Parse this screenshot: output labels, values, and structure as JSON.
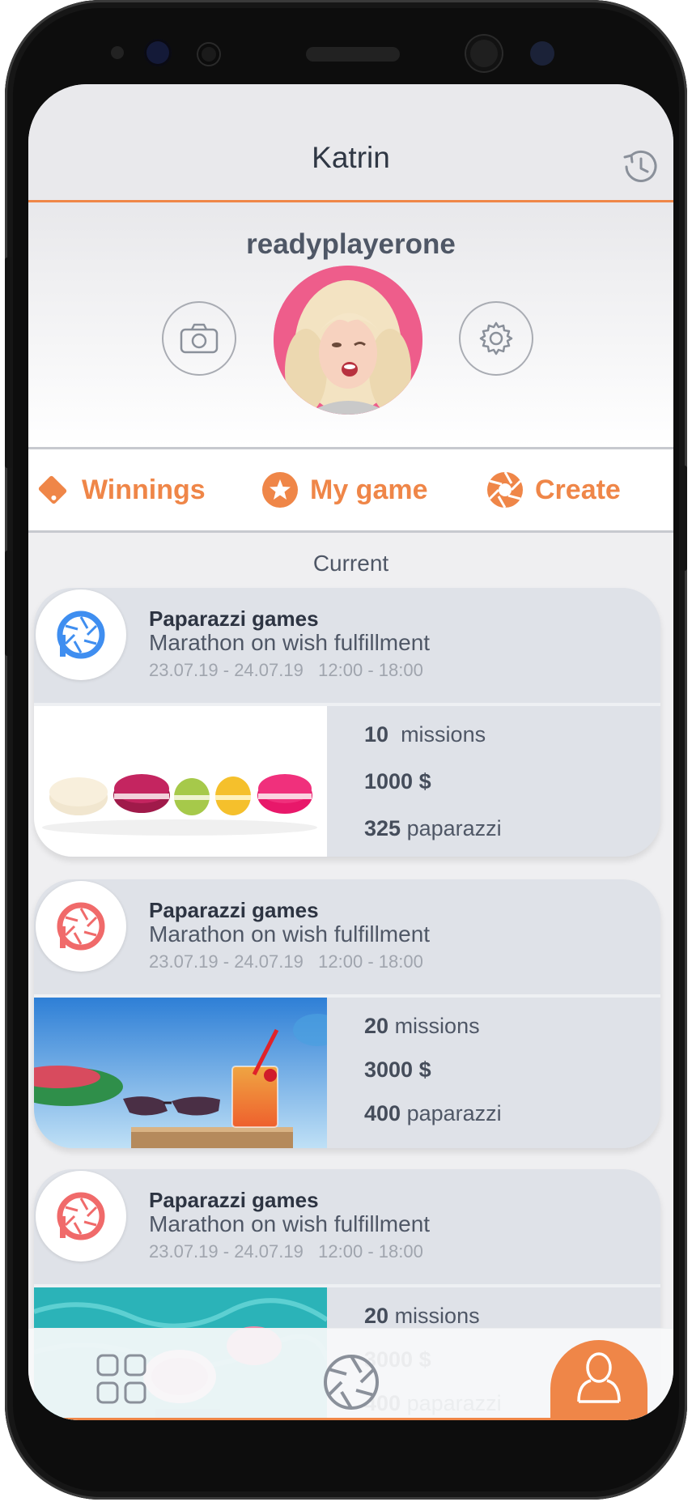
{
  "header": {
    "title": "Katrin",
    "history_icon": "history-icon"
  },
  "profile": {
    "username": "readyplayerone"
  },
  "tabs": [
    {
      "label": "Winnings",
      "icon": "ticket-icon"
    },
    {
      "label": "My game",
      "icon": "star-icon"
    },
    {
      "label": "Create",
      "icon": "aperture-icon"
    }
  ],
  "section": {
    "label": "Current"
  },
  "cards": [
    {
      "title": "Paparazzi games",
      "subtitle": "Marathon on wish fulfillment",
      "date": "23.07.19 - 24.07.19",
      "time": "12:00 - 18:00",
      "logo_color": "#3f8ef0",
      "missions": "10",
      "missions_label": "missions",
      "prize": "1000",
      "prize_unit": "$",
      "paparazzi": "325",
      "paparazzi_label": "paparazzi"
    },
    {
      "title": "Paparazzi games",
      "subtitle": "Marathon on wish fulfillment",
      "date": "23.07.19 - 24.07.19",
      "time": "12:00 - 18:00",
      "logo_color": "#f06a6a",
      "missions": "20",
      "missions_label": "missions",
      "prize": "3000",
      "prize_unit": "$",
      "paparazzi": "400",
      "paparazzi_label": "paparazzi"
    },
    {
      "title": "Paparazzi games",
      "subtitle": "Marathon on wish fulfillment",
      "date": "23.07.19 - 24.07.19",
      "time": "12:00 - 18:00",
      "logo_color": "#f06a6a",
      "missions": "20",
      "missions_label": "missions",
      "prize": "3000",
      "prize_unit": "$",
      "paparazzi": "400",
      "paparazzi_label": "paparazzi"
    }
  ],
  "colors": {
    "accent": "#ef8648",
    "text": "#4f5766",
    "card_bg": "#dfe2e8"
  }
}
